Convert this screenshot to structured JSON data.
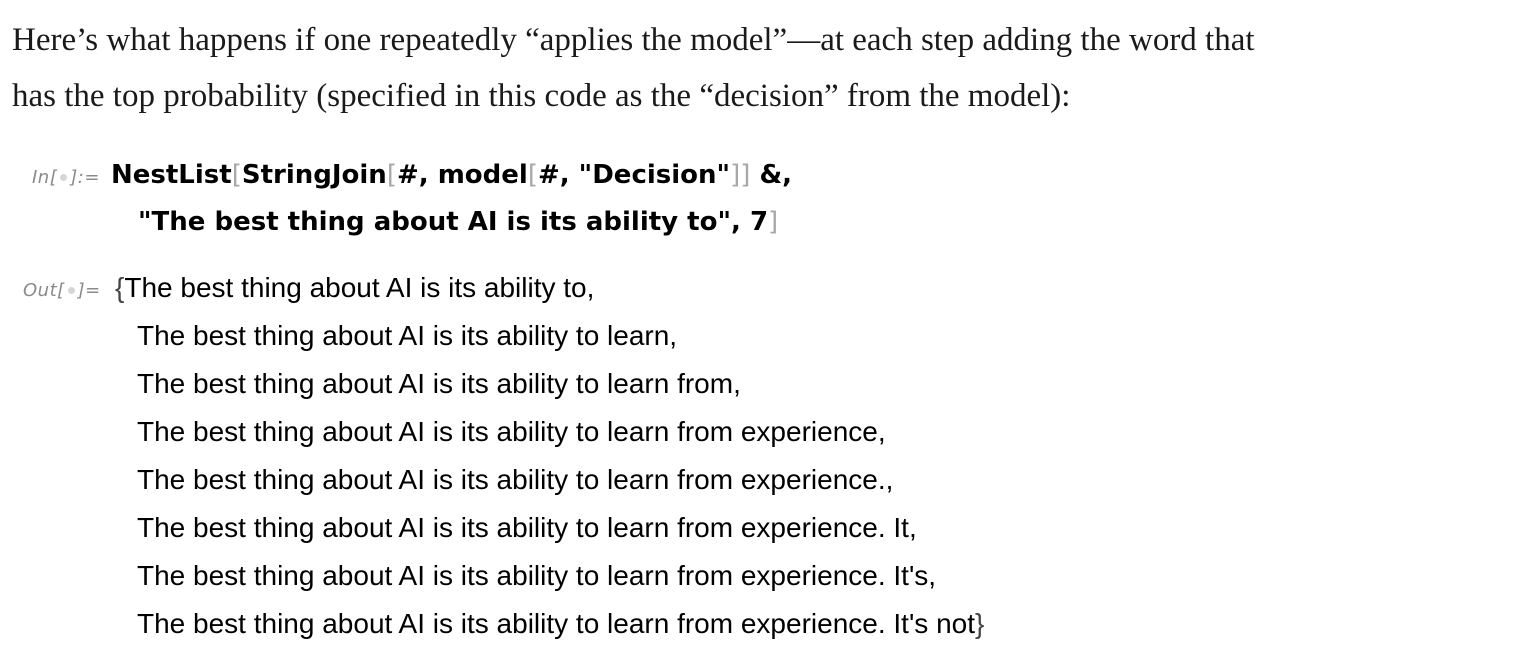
{
  "prose": {
    "line1": "Here’s what happens if one repeatedly “applies the model”—at each step adding the word that",
    "line2": "has the top probability (specified in this code as the “decision” from the model):"
  },
  "input_cell": {
    "label_prefix": "In[",
    "label_suffix": "]:=",
    "line1": {
      "func1": "NestList",
      "open1": "[",
      "func2": "StringJoin",
      "open2": "[",
      "arg1": "#, ",
      "func3": "model",
      "open3": "[",
      "arg2": "#, \"Decision\"",
      "close3": "]",
      "close2": "]",
      "tail": " &,"
    },
    "line2": {
      "string": "\"The best thing about AI is its ability to\", 7",
      "close1": "]"
    }
  },
  "output_cell": {
    "label_prefix": "Out[",
    "label_suffix": "]=",
    "open_brace": "{",
    "close_brace": "}",
    "items": [
      "The best thing about AI is its ability to,",
      "The best thing about AI is its ability to learn,",
      "The best thing about AI is its ability to learn from,",
      "The best thing about AI is its ability to learn from experience,",
      "The best thing about AI is its ability to learn from experience.,",
      "The best thing about AI is its ability to learn from experience. It,",
      "The best thing about AI is its ability to learn from experience. It's,",
      "The best thing about AI is its ability to learn from experience. It's not"
    ]
  }
}
